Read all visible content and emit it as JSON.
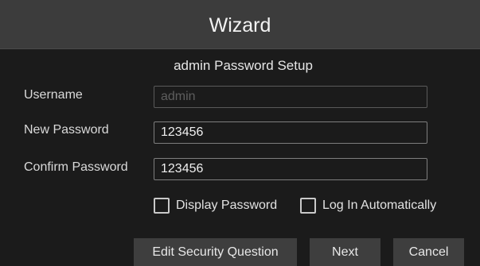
{
  "dialog": {
    "title": "Wizard",
    "subtitle": "admin Password Setup"
  },
  "form": {
    "username": {
      "label": "Username",
      "value": "",
      "placeholder": "admin"
    },
    "new_password": {
      "label": "New Password",
      "value": "123456"
    },
    "confirm_password": {
      "label": "Confirm Password",
      "value": "123456"
    }
  },
  "options": {
    "display_password": {
      "label": "Display Password",
      "checked": false
    },
    "log_in_automatically": {
      "label": "Log In Automatically",
      "checked": false
    }
  },
  "buttons": {
    "edit_security_question": "Edit Security Question",
    "next": "Next",
    "cancel": "Cancel"
  }
}
